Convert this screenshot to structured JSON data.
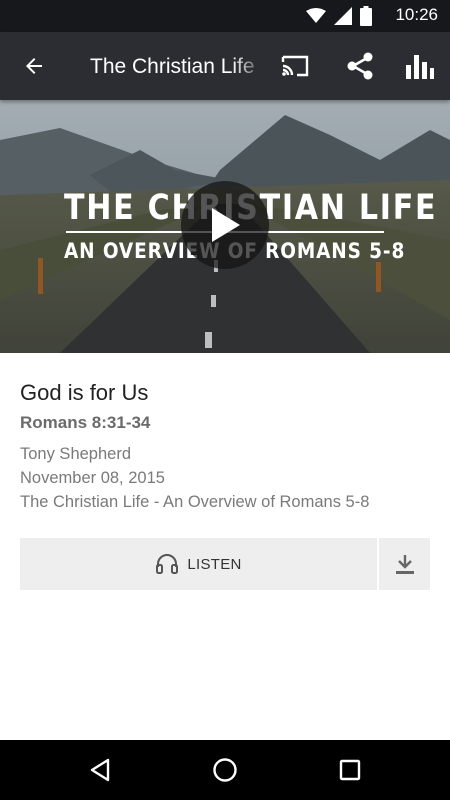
{
  "status_bar": {
    "time": "10:26",
    "icons": [
      "wifi-icon",
      "cellular-signal-icon",
      "battery-icon"
    ]
  },
  "app_bar": {
    "title": "The Christian Life",
    "actions": [
      "back-arrow-icon",
      "cast-icon",
      "share-icon",
      "stats-icon"
    ]
  },
  "hero": {
    "title_line_1": "THE CHRISTIAN LIFE",
    "title_line_2": "AN OVERVIEW OF ROMANS 5-8",
    "play_icon": "play-icon"
  },
  "sermon": {
    "title": "God is for Us",
    "scripture": "Romans 8:31-34",
    "speaker": "Tony Shepherd",
    "date": "November 08, 2015",
    "series": "The Christian Life - An Overview of Romans 5-8"
  },
  "actions": {
    "listen_label": "LISTEN",
    "listen_icon": "headphones-icon",
    "download_icon": "download-icon"
  },
  "nav_bar": {
    "buttons": [
      "nav-back-icon",
      "nav-home-icon",
      "nav-recents-icon"
    ]
  },
  "colors": {
    "status_bar": "#16181c",
    "app_bar": "#2b2d32",
    "button_bg": "#eeeeee",
    "title_text": "#222222",
    "meta_text": "#7a7a7a"
  }
}
